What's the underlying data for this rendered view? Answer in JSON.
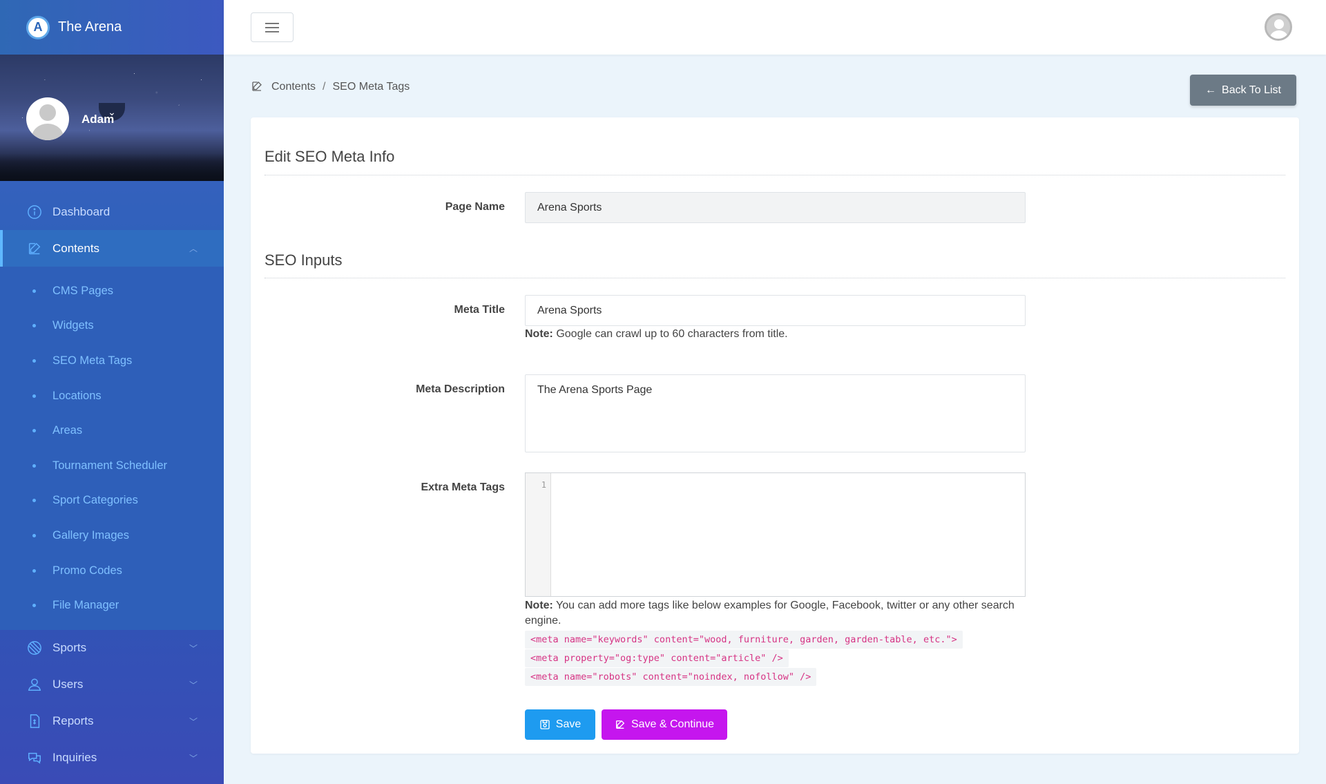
{
  "brand": {
    "name": "The Arena",
    "logo_letter": "A"
  },
  "profile": {
    "name": "Adam"
  },
  "sidebar": {
    "items_top": [
      {
        "label": "Dashboard",
        "icon": "info-icon"
      },
      {
        "label": "Contents",
        "icon": "edit-icon",
        "active": true
      }
    ],
    "contents_subitems": [
      "CMS Pages",
      "Widgets",
      "SEO Meta Tags",
      "Locations",
      "Areas",
      "Tournament Scheduler",
      "Sport Categories",
      "Gallery Images",
      "Promo Codes",
      "File Manager"
    ],
    "items_bottom": [
      {
        "label": "Sports",
        "icon": "ball-icon"
      },
      {
        "label": "Users",
        "icon": "user-icon"
      },
      {
        "label": "Reports",
        "icon": "report-icon"
      },
      {
        "label": "Inquiries",
        "icon": "chat-icon"
      }
    ]
  },
  "breadcrumb": {
    "root": "Contents",
    "separator": "/",
    "current": "SEO Meta Tags"
  },
  "toolbar": {
    "back_label": "Back To List"
  },
  "form": {
    "section1_title": "Edit SEO Meta Info",
    "page_name_label": "Page Name",
    "page_name_value": "Arena Sports",
    "section2_title": "SEO Inputs",
    "meta_title_label": "Meta Title",
    "meta_title_value": "Arena Sports",
    "meta_title_note_strong": "Note:",
    "meta_title_note": " Google can crawl up to 60 characters from title.",
    "meta_desc_label": "Meta Description",
    "meta_desc_value": "The Arena Sports Page",
    "extra_label": "Extra Meta Tags",
    "extra_line_number": "1",
    "extra_note_strong": "Note:",
    "extra_note": " You can add more tags like below examples for Google, Facebook, twitter or any other search engine.",
    "examples": [
      "<meta name=\"keywords\" content=\"wood, furniture, garden, garden-table, etc.\">",
      "<meta property=\"og:type\" content=\"article\" />",
      "<meta name=\"robots\" content=\"noindex, nofollow\" />"
    ],
    "save_label": "Save",
    "save_continue_label": "Save & Continue"
  }
}
